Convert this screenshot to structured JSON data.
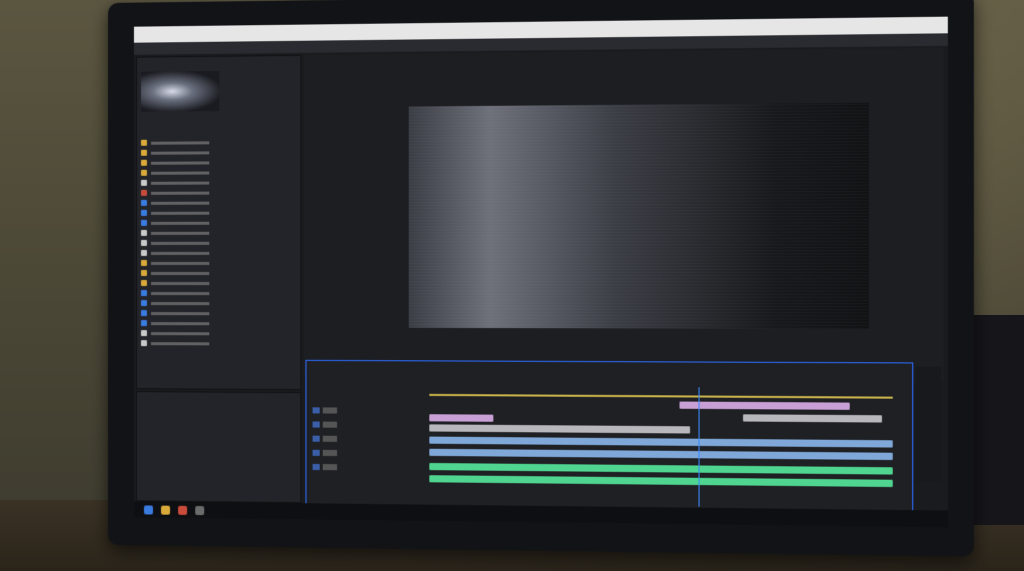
{
  "scene": {
    "wall_color": "#4d4937",
    "desk_color": "#2f281d"
  },
  "monitor": {
    "brand_text": ""
  },
  "app": {
    "title_items": [
      "",
      "",
      "",
      "",
      ""
    ],
    "menu_items": [
      "",
      "",
      "",
      ""
    ],
    "accent_color": "#2c6cff"
  },
  "project_panel": {
    "tab_label": "",
    "files": [
      {
        "icon_color": "#d9a93a"
      },
      {
        "icon_color": "#d9a93a"
      },
      {
        "icon_color": "#d9a93a"
      },
      {
        "icon_color": "#d9a93a"
      },
      {
        "icon_color": "#c9c9c9"
      },
      {
        "icon_color": "#c94b3b"
      },
      {
        "icon_color": "#3a7be0"
      },
      {
        "icon_color": "#3a7be0"
      },
      {
        "icon_color": "#3a7be0"
      },
      {
        "icon_color": "#c9c9c9"
      },
      {
        "icon_color": "#c9c9c9"
      },
      {
        "icon_color": "#c9c9c9"
      },
      {
        "icon_color": "#d9a93a"
      },
      {
        "icon_color": "#d9a93a"
      },
      {
        "icon_color": "#d9a93a"
      },
      {
        "icon_color": "#3a7be0"
      },
      {
        "icon_color": "#3a7be0"
      },
      {
        "icon_color": "#3a7be0"
      },
      {
        "icon_color": "#3a7be0"
      },
      {
        "icon_color": "#c9c9c9"
      },
      {
        "icon_color": "#c9c9c9"
      }
    ]
  },
  "timeline": {
    "timecode": "",
    "clip_colors": {
      "pink": "#c9a0d6",
      "grey": "#b8b8bc",
      "blue": "#7fa8d8",
      "green": "#4fd58f"
    }
  }
}
